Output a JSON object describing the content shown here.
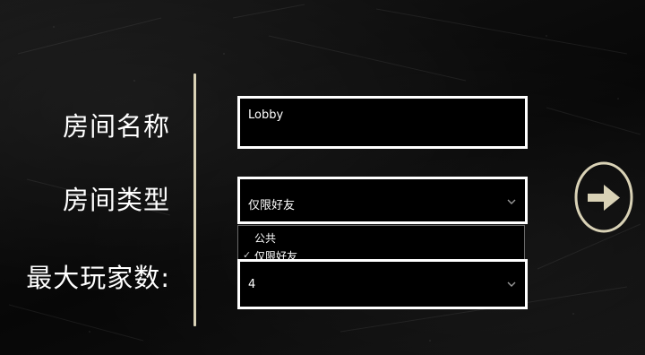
{
  "form": {
    "room_name_label": "房间名称",
    "room_type_label": "房间类型",
    "max_players_label": "最大玩家数:",
    "room_name_value": "Lobby",
    "room_type_value": "仅限好友",
    "max_players_value": "4"
  },
  "room_type_dropdown": {
    "options": [
      "公共",
      "仅限好友"
    ],
    "selected": "仅限好友"
  },
  "icons": {
    "next": "arrow-right-icon",
    "dropdown": "chevron-down-icon",
    "selected": "checkmark-icon"
  },
  "colors": {
    "divider": "#d9d2b6",
    "next_button": "#d9d2b6"
  }
}
